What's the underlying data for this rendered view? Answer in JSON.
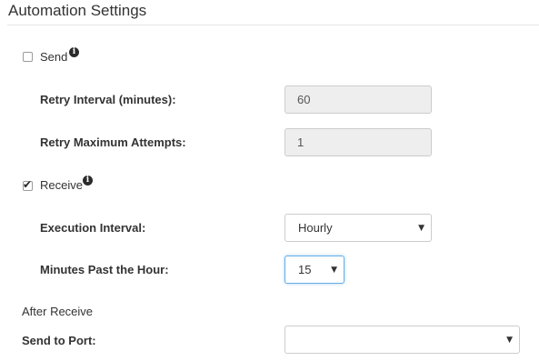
{
  "header": {
    "title": "Automation Settings"
  },
  "send": {
    "label": "Send",
    "checked": false,
    "info_icon": "info-icon",
    "retry_interval_label": "Retry Interval (minutes):",
    "retry_interval_value": "60",
    "retry_max_label": "Retry Maximum Attempts:",
    "retry_max_value": "1"
  },
  "receive": {
    "label": "Receive",
    "checked": true,
    "info_icon": "info-icon",
    "execution_interval_label": "Execution Interval:",
    "execution_interval_value": "Hourly",
    "minutes_past_label": "Minutes Past the Hour:",
    "minutes_past_value": "15"
  },
  "after_receive": {
    "label": "After Receive",
    "send_to_port_label": "Send to Port:",
    "send_to_port_value": ""
  },
  "icons": {
    "caret": "▼",
    "info": "i"
  }
}
